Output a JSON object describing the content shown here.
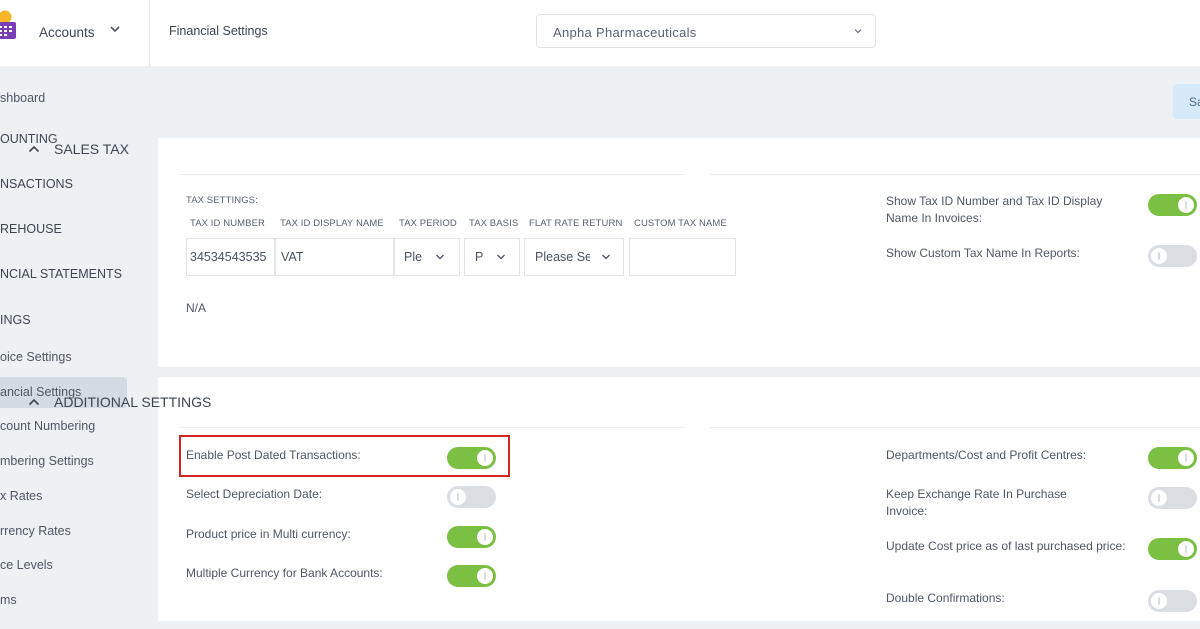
{
  "app": {
    "name": "Accounts"
  },
  "sidebar": {
    "items": [
      {
        "label": "shboard",
        "kind": "link"
      },
      {
        "label": "OUNTING",
        "kind": "head"
      },
      {
        "label": "NSACTIONS",
        "kind": "head"
      },
      {
        "label": "REHOUSE",
        "kind": "head"
      },
      {
        "label": "NCIAL STATEMENTS",
        "kind": "head"
      },
      {
        "label": "INGS",
        "kind": "head"
      },
      {
        "label": "oice Settings",
        "kind": "link"
      },
      {
        "label": "ancial Settings",
        "kind": "link",
        "active": true
      },
      {
        "label": "count Numbering",
        "kind": "link"
      },
      {
        "label": "mbering Settings",
        "kind": "link"
      },
      {
        "label": "x Rates",
        "kind": "link"
      },
      {
        "label": "rrency Rates",
        "kind": "link"
      },
      {
        "label": "ce Levels",
        "kind": "link"
      },
      {
        "label": "ms",
        "kind": "link"
      }
    ]
  },
  "header": {
    "title": "Financial Settings",
    "company": "Anpha Pharmaceuticals",
    "save_label": "Sa"
  },
  "sales_tax": {
    "title": "SALES TAX",
    "tax_settings_label": "TAX SETTINGS:",
    "columns": [
      "TAX ID NUMBER",
      "TAX ID DISPLAY NAME",
      "TAX PERIOD",
      "TAX BASIS",
      "FLAT RATE RETURN",
      "CUSTOM TAX NAME"
    ],
    "values": {
      "tax_id_number": "34534543535",
      "tax_id_display_name": "VAT",
      "tax_period": "Ple",
      "tax_basis": "P",
      "flat_rate_return": "Please Se",
      "custom_tax_name": ""
    },
    "na_text": "N/A",
    "options": [
      {
        "label": "Show Tax ID Number and Tax ID Display Name In Invoices:",
        "on": true
      },
      {
        "label": "Show Custom Tax Name In Reports:",
        "on": false
      }
    ]
  },
  "additional_settings": {
    "title": "ADDITIONAL SETTINGS",
    "left": [
      {
        "label": "Enable Post Dated Transactions:",
        "on": true
      },
      {
        "label": "Select Depreciation Date:",
        "on": false
      },
      {
        "label": "Product price in Multi currency:",
        "on": true
      },
      {
        "label": "Multiple Currency for Bank Accounts:",
        "on": true
      }
    ],
    "right": [
      {
        "label": "Departments/Cost and Profit Centres:",
        "on": true
      },
      {
        "label": "Keep Exchange Rate In Purchase Invoice:",
        "on": false
      },
      {
        "label": "Update Cost price as of last purchased price:",
        "on": true
      },
      {
        "label": "Double Confirmations:",
        "on": false
      }
    ]
  },
  "colors": {
    "toggle_on": "#7bc043",
    "toggle_off": "#dadde2",
    "highlight": "#d32525",
    "active_nav": "#d5dbe2"
  }
}
